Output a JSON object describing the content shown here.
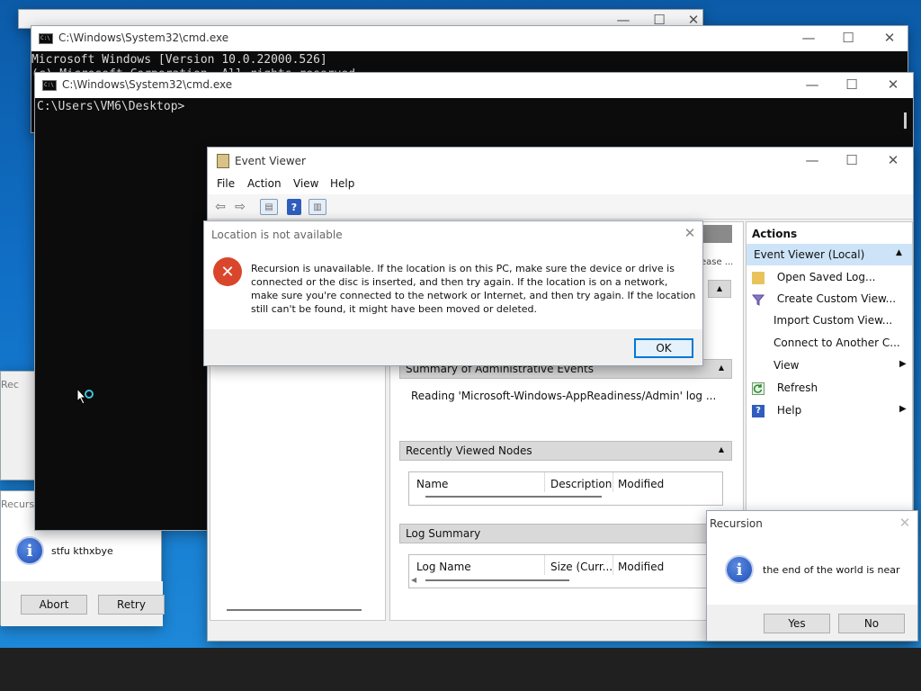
{
  "cmd_back": {
    "title": "C:\\Windows\\System32\\cmd.exe",
    "line1": "Microsoft Windows [Version 10.0.22000.526]",
    "line2": "(c) Microsoft Corporation. All rights reserved."
  },
  "cmd_front": {
    "title": "C:\\Windows\\System32\\cmd.exe",
    "prompt": "C:\\Users\\VM6\\Desktop>"
  },
  "event_viewer": {
    "title": "Event Viewer",
    "menu": [
      "File",
      "Action",
      "View",
      "Help"
    ],
    "partial_text": "ease ...",
    "summary_header": "Summary of Administrative Events",
    "reading_text": "Reading 'Microsoft-Windows-AppReadiness/Admin' log ...",
    "recent_header": "Recently Viewed Nodes",
    "recent_columns": [
      "Name",
      "Description",
      "Modified"
    ],
    "log_summary_header": "Log Summary",
    "log_columns": [
      "Log Name",
      "Size (Curr...",
      "Modified"
    ],
    "actions_header": "Actions",
    "actions_group": "Event Viewer (Local)",
    "actions": [
      "Open Saved Log...",
      "Create Custom View...",
      "Import Custom View...",
      "Connect to Another C...",
      "View",
      "Refresh",
      "Help"
    ]
  },
  "location_dialog": {
    "title": "Location is not available",
    "message": "Recursion is unavailable. If the location is on this PC, make sure the device or drive is connected or the disc is inserted, and then try again. If the location is on a network, make sure you're connected to the network or Internet, and then try again. If the location still can't be found, it might have been moved or deleted.",
    "ok_label": "OK"
  },
  "recursion_dialog": {
    "title": "Recursion",
    "message": "the end of the world is near",
    "yes_label": "Yes",
    "no_label": "No"
  },
  "left_dialog": {
    "title_fragment": "Recursion",
    "rec_fragment": "Rec",
    "message": "stfu kthxbye",
    "abort_label": "Abort",
    "retry_label": "Retry"
  },
  "colors": {
    "desktop_blue": "#1070c7",
    "taskbar": "#202020",
    "accent": "#0078d7",
    "error_red": "#d9462b"
  }
}
